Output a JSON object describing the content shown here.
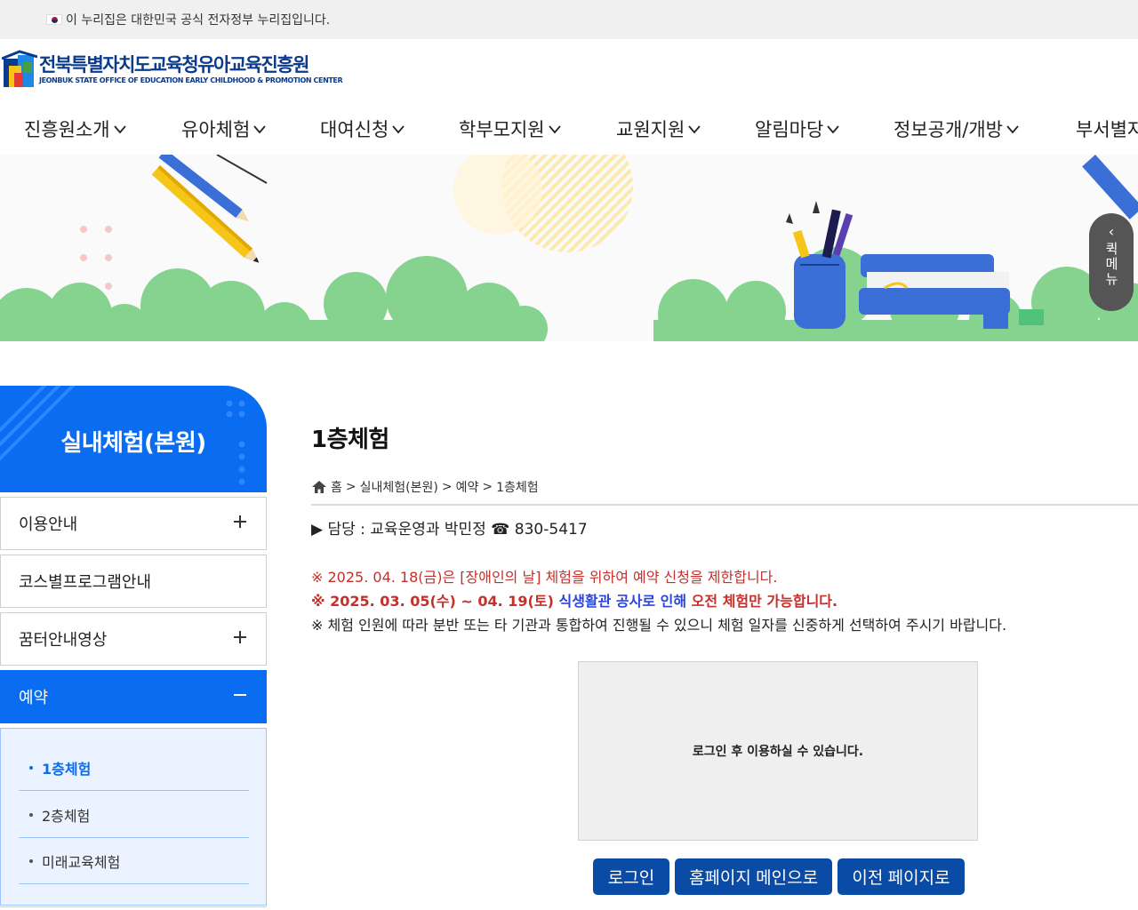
{
  "gov_banner": {
    "text": "이 누리집은 대한민국 공식 전자정부 누리집입니다.",
    "flag_icon": "korea-flag-icon"
  },
  "header": {
    "logo_title": "전북특별자치도교육청유아교육진흥원",
    "logo_sub": "JEONBUK STATE OFFICE OF EDUCATION EARLY CHILDHOOD & PROMOTION CENTER"
  },
  "gnb": {
    "items": [
      "진흥원소개",
      "유아체험",
      "대여신청",
      "학부모지원",
      "교원지원",
      "알림마당",
      "정보공개/개방",
      "부서별자료실"
    ],
    "chevron_icon": "chevron-down-icon"
  },
  "quick_menu": {
    "arrow": "‹",
    "label": "퀵메뉴"
  },
  "sidebar": {
    "title": "실내체험(본원)",
    "menu": [
      {
        "label": "이용안내",
        "sign": "plus"
      },
      {
        "label": "코스별프로그램안내",
        "sign": ""
      },
      {
        "label": "꿈터안내영상",
        "sign": "plus"
      },
      {
        "label": "예약",
        "sign": "minus"
      }
    ],
    "sub_items": [
      "1층체험",
      "2층체험",
      "미래교육체험"
    ],
    "active_sub": "1층체험"
  },
  "content": {
    "title": "1층체험",
    "breadcrumb": [
      "홈",
      "실내체험(본원)",
      "예약",
      "1층체험"
    ],
    "breadcrumb_sep": ">",
    "manager": "▶ 담당 : 교육운영과 박민정 ☎ 830-5417",
    "notices": {
      "n1": "※ 2025. 04. 18(금)은 [장애인의 날] 체험을 위하여 예약 신청을 제한합니다.",
      "n2_a": "※ 2025. 03. 05(수) ~ 04. 19(토) ",
      "n2_b": "식생활관 공사로 인해",
      "n2_c": " 오전 체험만 가능합니다.",
      "n3": "※ 체험 인원에 따라 분반 또는 타 기관과 통합하여 진행될 수 있으니 체험 일자를 신중하게 선택하여 주시기 바랍니다."
    },
    "login_message": "로그인 후 이용하실 수 있습니다.",
    "buttons": {
      "login": "로그인",
      "main": "홈페이지 메인으로",
      "prev": "이전 페이지로"
    }
  },
  "colors": {
    "primary": "#0a6cf0",
    "navy": "#0a4ba6",
    "notice_red": "#c4302b",
    "notice_blue": "#2b45d8"
  }
}
